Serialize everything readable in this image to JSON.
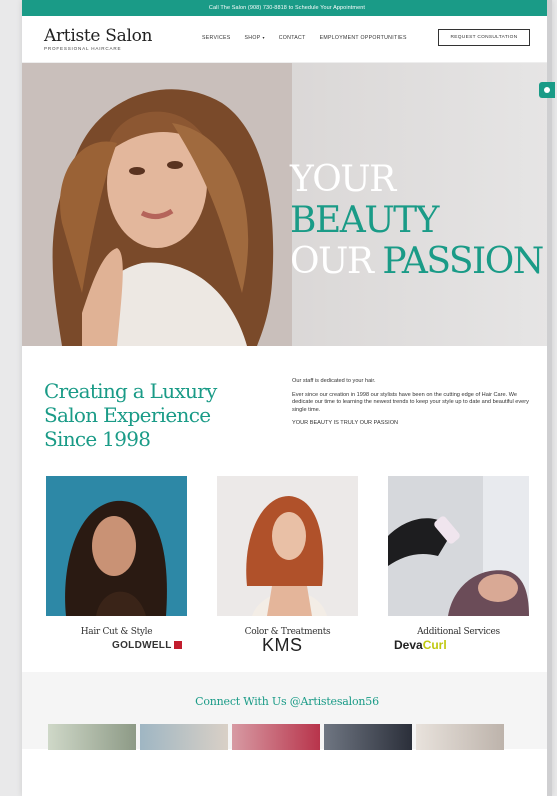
{
  "topbar": {
    "text": "Call The Salon (908) 730-8818 to Schedule Your Appointment"
  },
  "logo": {
    "title": "Artiste Salon",
    "subtitle": "PROFESSIONAL HAIRCARE"
  },
  "nav": {
    "items": [
      {
        "label": "SERVICES"
      },
      {
        "label": "SHOP",
        "caret": "▾"
      },
      {
        "label": "CONTACT"
      },
      {
        "label": "EMPLOYMENT OPPORTUNITIES"
      }
    ],
    "cta_label": "REQUEST CONSULTATION"
  },
  "hero": {
    "line1_white": "YOUR ",
    "line1_green": "BEAUTY",
    "line2_white": "OUR ",
    "line2_green": "PASSION"
  },
  "intro": {
    "title": "Creating a Luxury Salon Experience Since 1998",
    "p1": "Our staff is dedicated to your hair.",
    "p2": "Ever since our creation in 1998 our stylists have been on the cutting edge of Hair Care. We dedicate our time to learning the newest trends to keep your style up to date and beautiful every single time.",
    "p3": "YOUR BEAUTY IS TRULY OUR PASSION"
  },
  "services": [
    {
      "label": "Hair Cut & Style"
    },
    {
      "label": "Color & Treatments"
    },
    {
      "label": "Additional Services"
    }
  ],
  "brands": {
    "goldwell": "GOLDWELL",
    "kms": "KMS",
    "deva_a": "Deva",
    "deva_b": "Curl"
  },
  "footer": {
    "title": "Connect With Us @Artistesalon56"
  },
  "colors": {
    "brand": "#1a9b87",
    "goldwell_red": "#c21d2e",
    "devacurl_yellow": "#c0c80f"
  }
}
